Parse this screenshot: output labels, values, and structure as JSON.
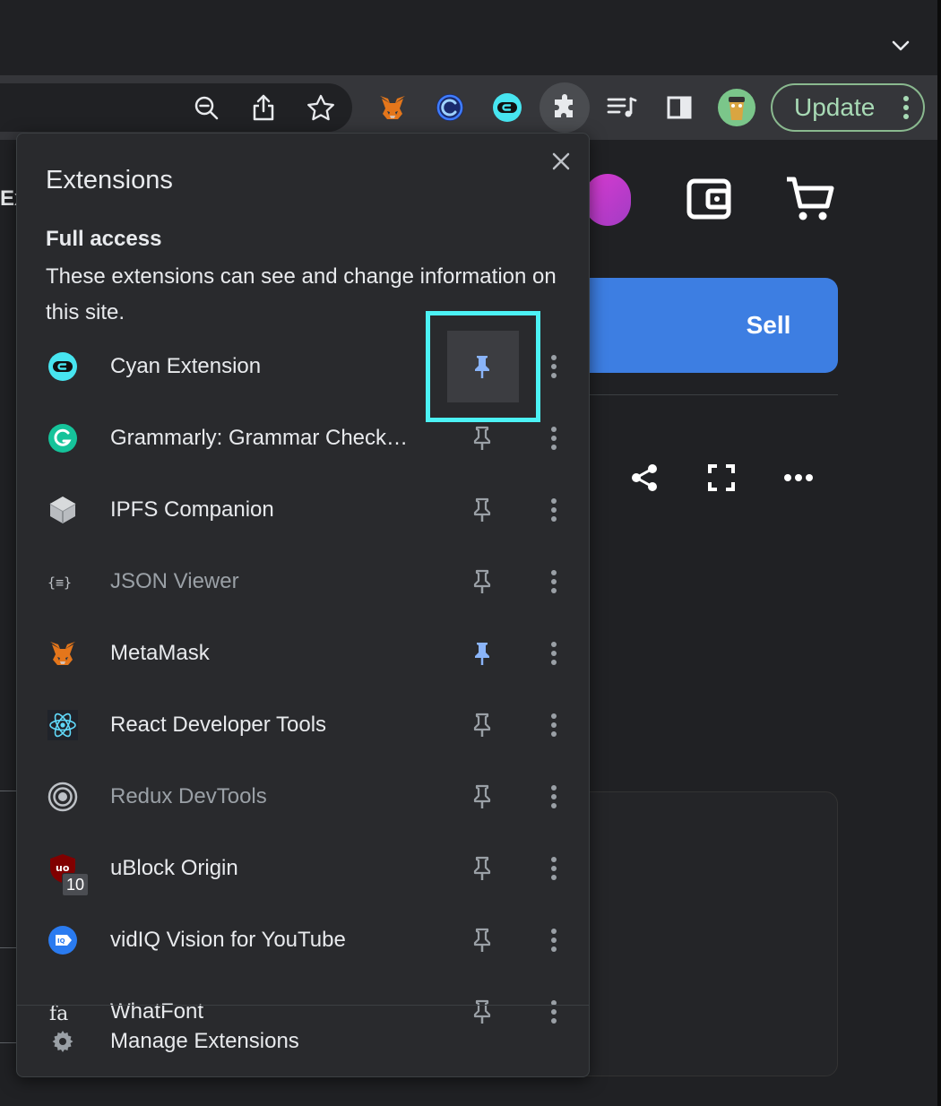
{
  "toolbar": {
    "update_label": "Update"
  },
  "page": {
    "sell_label": "Sell",
    "partial_text": "Ex"
  },
  "popup": {
    "title": "Extensions",
    "section_title": "Full access",
    "section_desc": "These extensions can see and change information on this site.",
    "extensions": [
      {
        "name": "Cyan Extension",
        "icon": "cyan-extension-icon",
        "pinned": true,
        "dim": false
      },
      {
        "name": "Grammarly: Grammar Checker and Writing App",
        "icon": "grammarly-icon",
        "pinned": false,
        "dim": false
      },
      {
        "name": "IPFS Companion",
        "icon": "ipfs-cube-icon",
        "pinned": false,
        "dim": false
      },
      {
        "name": "JSON Viewer",
        "icon": "json-braces-icon",
        "pinned": false,
        "dim": true
      },
      {
        "name": "MetaMask",
        "icon": "metamask-fox-icon",
        "pinned": true,
        "dim": false
      },
      {
        "name": "React Developer Tools",
        "icon": "react-atom-icon",
        "pinned": false,
        "dim": false
      },
      {
        "name": "Redux DevTools",
        "icon": "redux-icon",
        "pinned": false,
        "dim": true
      },
      {
        "name": "uBlock Origin",
        "icon": "ublock-shield-icon",
        "pinned": false,
        "dim": false,
        "badge": "10"
      },
      {
        "name": "vidIQ Vision for YouTube",
        "icon": "vidiq-icon",
        "pinned": false,
        "dim": false
      },
      {
        "name": "WhatFont",
        "icon": "whatfont-icon",
        "pinned": false,
        "dim": false
      }
    ],
    "manage_label": "Manage Extensions"
  },
  "colors": {
    "pin_active": "#8ab4f8",
    "pin_inactive": "#9aa0a6",
    "highlight_box": "#4cf2f5",
    "sell_button": "#3d7ee2",
    "update_border": "#8ab98f"
  }
}
